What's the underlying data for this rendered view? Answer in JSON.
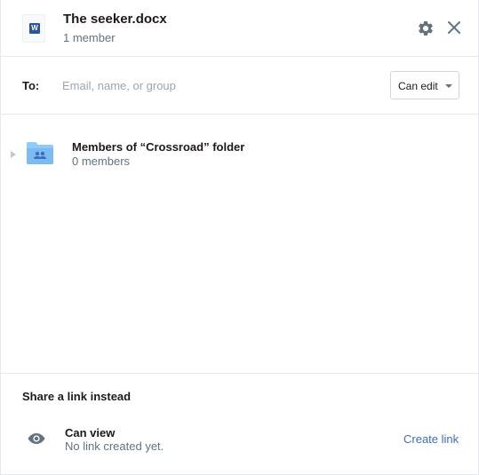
{
  "header": {
    "file_badge": "W",
    "title": "The seeker.docx",
    "subtitle": "1 member"
  },
  "share_to": {
    "label": "To:",
    "input_value": "",
    "placeholder": "Email, name, or group",
    "permission": "Can edit"
  },
  "members": [
    {
      "title": "Members of “Crossroad” folder",
      "subtitle": "0 members"
    }
  ],
  "link": {
    "heading": "Share a link instead",
    "access_title": "Can view",
    "access_status": "No link created yet.",
    "action": "Create link"
  },
  "colors": {
    "word_blue": "#2b579a",
    "folder_blue": "#90caf9",
    "link_blue": "#3d6eb9",
    "muted_text": "#637282",
    "divider": "#e6e8eb"
  },
  "icons": [
    "word-file-icon",
    "gear-icon",
    "close-icon",
    "expand-arrow-icon",
    "shared-folder-icon",
    "eye-icon"
  ]
}
